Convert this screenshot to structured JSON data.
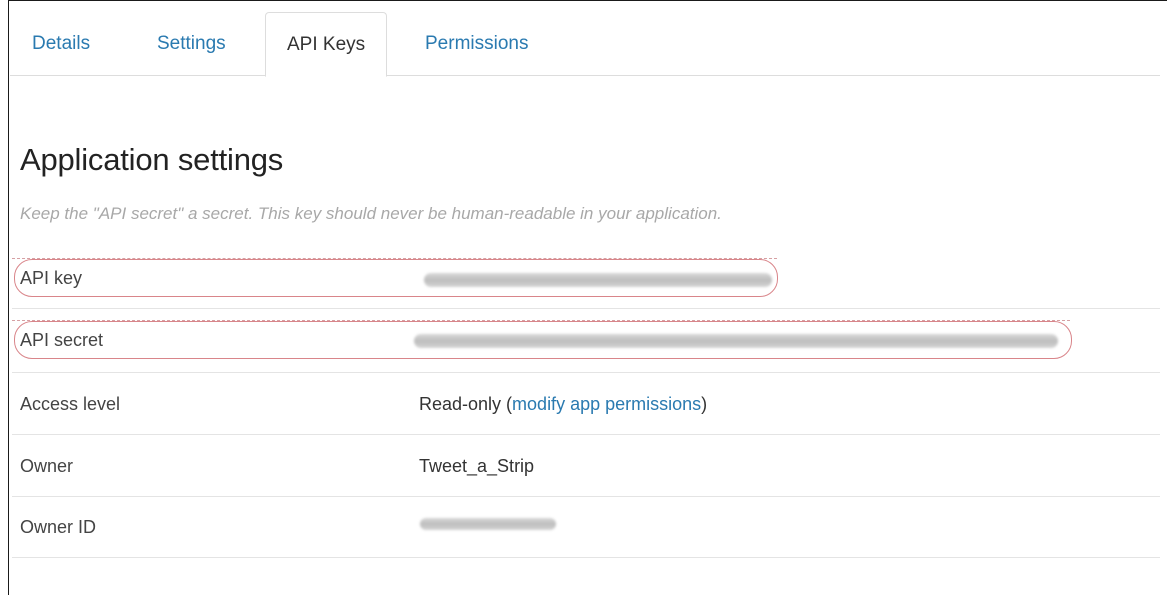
{
  "tabs": [
    {
      "label": "Details",
      "active": false
    },
    {
      "label": "Settings",
      "active": false
    },
    {
      "label": "API Keys",
      "active": true
    },
    {
      "label": "Permissions",
      "active": false
    }
  ],
  "page": {
    "title": "Application settings",
    "subtitle": "Keep the \"API secret\" a secret. This key should never be human-readable in your application."
  },
  "rows": {
    "api_key": {
      "label": "API key",
      "value": "[redacted]"
    },
    "api_secret": {
      "label": "API secret",
      "value": "[redacted]"
    },
    "access_level": {
      "label": "Access level",
      "value_prefix": "Read-only (",
      "link": "modify app permissions",
      "value_suffix": ")"
    },
    "owner": {
      "label": "Owner",
      "value": "Tweet_a_Strip"
    },
    "owner_id": {
      "label": "Owner ID",
      "value": "[redacted]"
    }
  },
  "colors": {
    "link": "#2a7ab0",
    "highlight_circle": "#d9858a"
  }
}
